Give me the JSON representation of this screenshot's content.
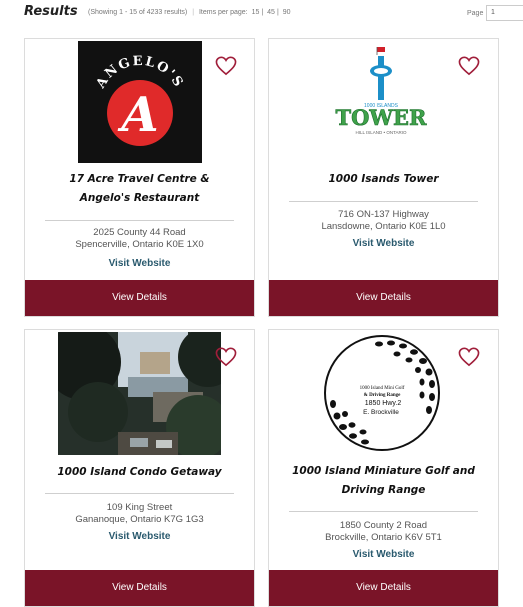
{
  "header": {
    "title": "Results",
    "showing": "(Showing 1 - 15 of 4233 results)",
    "separator": "|",
    "items_label": "Items per page:",
    "per_page_options": [
      "15",
      "45",
      "90"
    ],
    "option_separator": "|",
    "page_label": "Page",
    "page_value": "1"
  },
  "colors": {
    "accent": "#7a1428",
    "link": "#2a5a6e",
    "heart": "#a01e3a"
  },
  "cards": [
    {
      "name_line1": "17 Acre Travel Centre &",
      "name_line2": "Angelo's Restaurant",
      "address_line1": "2025 County 44 Road",
      "address_line2": "Spencerville, Ontario K0E 1X0",
      "link": "Visit Website",
      "button": "View Details",
      "logo_text": "ANGELO'S",
      "logo_letter": "A"
    },
    {
      "name_line1": "1000 Isands Tower",
      "name_line2": "",
      "address_line1": "716 ON-137 Highway",
      "address_line2": "Lansdowne, Ontario K0E 1L0",
      "link": "Visit Website",
      "button": "View Details",
      "logo_small": "1000 ISLANDS",
      "logo_big": "TOWER",
      "logo_sub": "HILL ISLAND • ONTARIO"
    },
    {
      "name_line1": "1000 Island Condo Getaway",
      "name_line2": "",
      "address_line1": "109 King Street",
      "address_line2": "Gananoque, Ontario K7G 1G3",
      "link": "Visit Website",
      "button": "View Details"
    },
    {
      "name_line1": "1000 Island Miniature Golf and",
      "name_line2": "Driving Range",
      "address_line1": "1850 County 2 Road",
      "address_line2": "Brockville, Ontario K6V 5T1",
      "link": "Visit Website",
      "button": "View Details",
      "logo_line1": "1000 Island Mini Golf",
      "logo_line2": "& Driving Range",
      "logo_line3": "1850  Hwy.2",
      "logo_line4": "E. Brockville"
    }
  ]
}
